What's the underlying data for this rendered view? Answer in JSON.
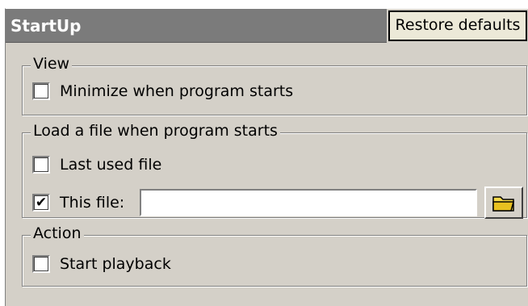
{
  "header": {
    "title": "StartUp",
    "restore_label": "Restore defaults"
  },
  "groups": {
    "view": {
      "legend": "View",
      "minimize_label": "Minimize when program starts",
      "minimize_checked": false
    },
    "load": {
      "legend": "Load a file when program starts",
      "last_used_label": "Last used file",
      "last_used_checked": false,
      "this_file_label": "This file:",
      "this_file_checked": true,
      "this_file_value": "",
      "browse_icon": "folder-icon"
    },
    "action": {
      "legend": "Action",
      "playback_label": "Start playback",
      "playback_checked": false
    }
  },
  "colors": {
    "header_bg": "#7b7b7b",
    "panel_bg": "#d4d0c8",
    "folder_yellow": "#f5d94a"
  },
  "icons": {
    "checked_glyph": "✔"
  }
}
